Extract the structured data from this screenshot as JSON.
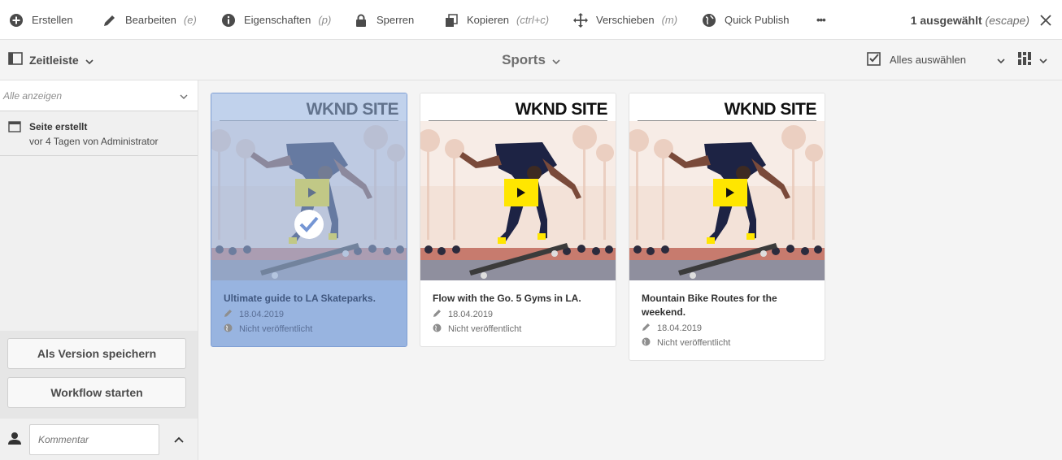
{
  "toolbar": {
    "create": "Erstellen",
    "edit": "Bearbeiten",
    "edit_shortcut": "(e)",
    "properties": "Eigenschaften",
    "properties_shortcut": "(p)",
    "lock": "Sperren",
    "copy": "Kopieren",
    "copy_shortcut": "(ctrl+c)",
    "move": "Verschieben",
    "move_shortcut": "(m)",
    "quick_publish": "Quick Publish",
    "more": "•••",
    "selected": "1 ausgewählt",
    "selected_shortcut": "(escape)"
  },
  "actionbar": {
    "rail": "Zeitleiste",
    "title": "Sports",
    "select_all": "Alles auswählen"
  },
  "sidebar": {
    "filter": "Alle anzeigen",
    "entry_title": "Seite erstellt",
    "entry_sub": "vor 4 Tagen von Administrator",
    "save_version": "Als Version speichern",
    "start_workflow": "Workflow starten",
    "comment_placeholder": "Kommentar"
  },
  "cards": [
    {
      "brand": "WKND SITE",
      "title": "Ultimate guide to LA Skateparks.",
      "date": "18.04.2019",
      "status": "Nicht veröffentlicht",
      "selected": true
    },
    {
      "brand": "WKND SITE",
      "title": "Flow with the Go. 5 Gyms in LA.",
      "date": "18.04.2019",
      "status": "Nicht veröffentlicht",
      "selected": false
    },
    {
      "brand": "WKND SITE",
      "title": "Mountain Bike Routes for the weekend.",
      "date": "18.04.2019",
      "status": "Nicht veröffentlicht",
      "selected": false
    }
  ],
  "colors": {
    "selection": "#98b4e0",
    "play": "#ffe600"
  }
}
